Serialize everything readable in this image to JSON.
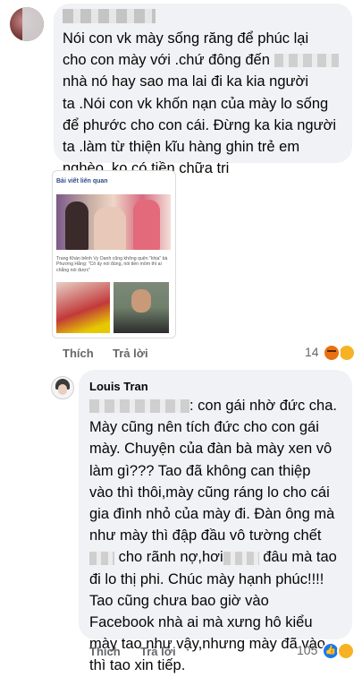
{
  "comment1": {
    "text_lines": [
      "Nói con vk mày sống răng để phúc lại",
      "cho con mày với .chứ đông đến",
      "nhà nó hay sao ma lai đi ka kia người",
      "ta .Nói con vk khốn nạn của mày lo sống",
      "để phước cho con cái. Đừng ka kia người",
      "ta .làm từ thiện kĩu hàng ghin trẻ em",
      "nghèo .ko có tiền chữa tri"
    ],
    "card": {
      "title": "Bài viết liên quan",
      "caption": "Trang Khàn bênh Vy Oanh cũng không quên \"khịa\" bà Phương Hằng: \"Cô ấy nói đúng, nói tiền mồm thì ai chẳng nói được\""
    },
    "like_label": "Thích",
    "reply_label": "Trả lời",
    "reaction_count": "14"
  },
  "comment2": {
    "author": "Louis Tran",
    "line1_suffix": ": con gái nhờ đức cha.",
    "text_lines_a": [
      "Mày cũng nên tích đức cho con gái",
      "mày. Chuyện của đàn bà mày xen vô",
      "làm gì??? Tao đã không can thiệp",
      "vào thì thôi,mày cũng ráng lo cho cái",
      "gia đình nhỏ của mày đi. Đàn ông mà",
      "như mày thì đập đầu vô tường chết"
    ],
    "line8_a": "cho rãnh nợ,hơi",
    "line8_b": "đâu mà tao",
    "text_lines_b": [
      "đi lo thị phi. Chúc mày hạnh phúc!!!!",
      "Tao cũng chưa bao giờ vào",
      "Facebook nhà ai mà xưng hô kiểu",
      "mày tao như vậy,nhưng mày đã vào",
      "thì tao xin tiếp."
    ],
    "like_label": "Thích",
    "reply_label": "Trả lời",
    "reaction_count": "105"
  }
}
